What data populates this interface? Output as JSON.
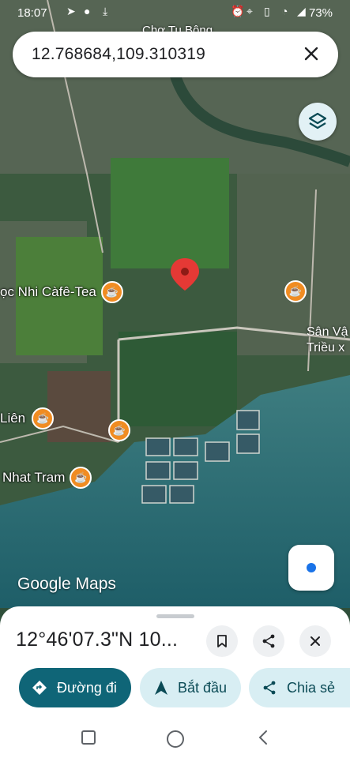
{
  "status_bar": {
    "time": "18:07",
    "battery": "73%"
  },
  "search": {
    "query": "12.768684,109.310319",
    "clear_icon": "close-icon"
  },
  "map": {
    "top_label": "Chợ Tu Bông",
    "pois": [
      {
        "label": "Ngọc Nhi Càfê-Tea",
        "shown": "ọc Nhi Càfê-Tea"
      },
      {
        "label": "Liên"
      },
      {
        "label": "Nhat Tram"
      }
    ],
    "right_label_line1": "Sân Vậ",
    "right_label_line2": "Triều x",
    "watermark": "Google Maps"
  },
  "sheet": {
    "title": "12°46'07.3\"N 10...",
    "actions": {
      "directions": "Đường đi",
      "start": "Bắt đầu",
      "share": "Chia sẻ"
    }
  },
  "colors": {
    "accent": "#0f6577",
    "chip": "#d8eef3",
    "poi": "#f08c22",
    "pin": "#e53935"
  }
}
